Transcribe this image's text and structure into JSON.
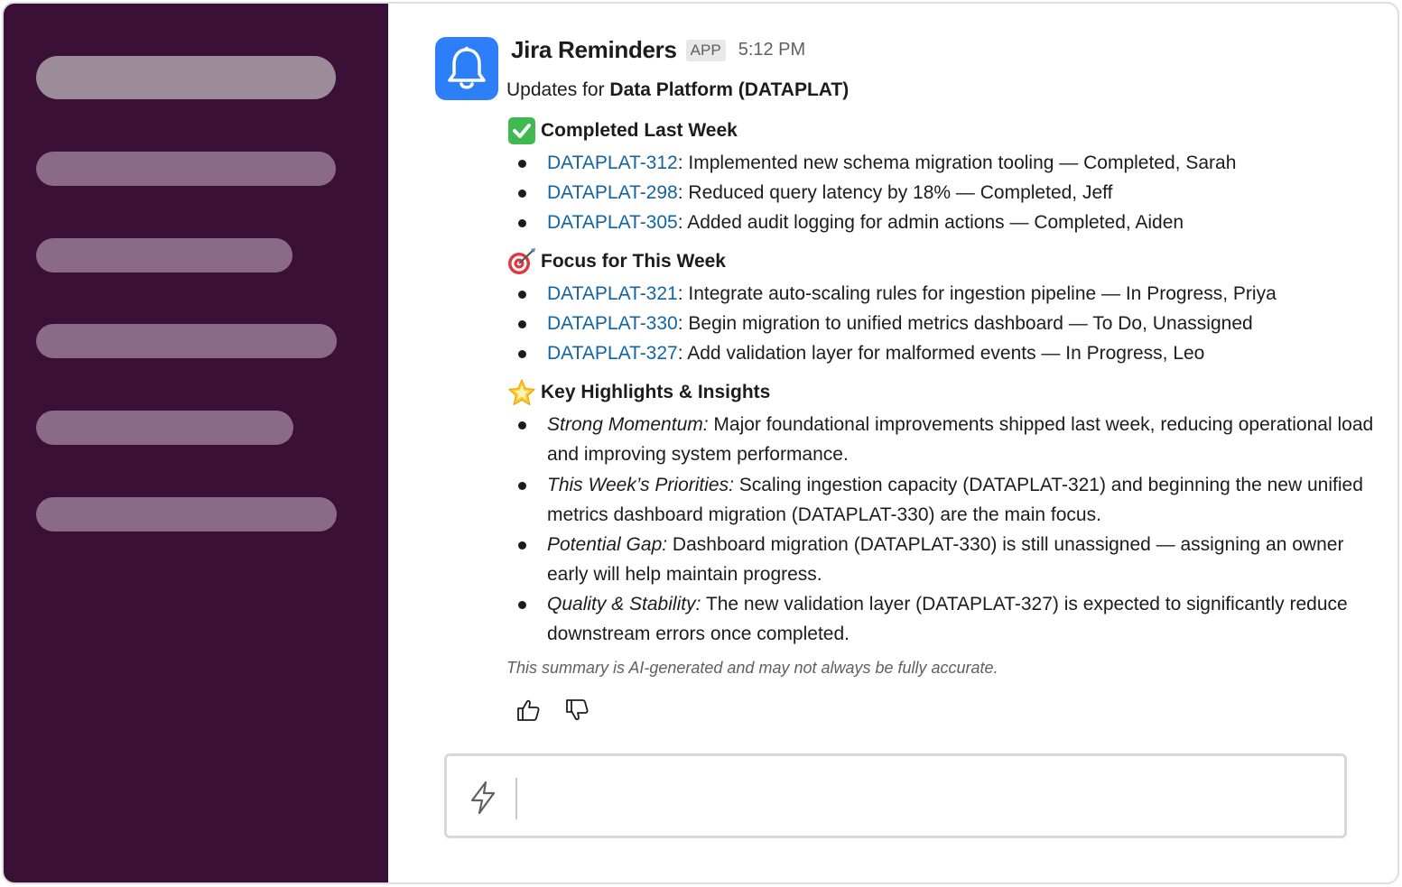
{
  "sidebar": {
    "items": [
      "",
      "",
      "",
      "",
      "",
      ""
    ]
  },
  "message": {
    "bot_name": "Jira Reminders",
    "app_badge": "APP",
    "timestamp": "5:12 PM",
    "avatar_icon": "bell-icon",
    "intro_prefix": "Updates for ",
    "intro_project": "Data Platform (DATAPLAT)"
  },
  "sections": {
    "completed": {
      "emoji": "check-mark-icon",
      "title": "Completed Last Week",
      "items": [
        {
          "key": "DATAPLAT-312",
          "text": ": Implemented new schema migration tooling — Completed, Sarah"
        },
        {
          "key": "DATAPLAT-298",
          "text": ": Reduced query latency by 18% — Completed, Jeff"
        },
        {
          "key": "DATAPLAT-305",
          "text": ": Added audit logging for admin actions — Completed, Aiden"
        }
      ]
    },
    "focus": {
      "emoji": "target-icon",
      "title": "Focus for This Week",
      "items": [
        {
          "key": "DATAPLAT-321",
          "text": ": Integrate auto-scaling rules for ingestion pipeline — In Progress, Priya"
        },
        {
          "key": "DATAPLAT-330",
          "text": ": Begin migration to unified metrics dashboard — To Do, Unassigned"
        },
        {
          "key": "DATAPLAT-327",
          "text": ": Add validation layer for malformed events — In Progress, Leo"
        }
      ]
    },
    "highlights": {
      "emoji": "star-icon",
      "title": "Key Highlights & Insights",
      "items": [
        {
          "label": "Strong Momentum:",
          "text": " Major foundational improvements shipped last week, reducing operational load and improving system performance."
        },
        {
          "label": "This Week’s Priorities:",
          "text": " Scaling ingestion capacity (DATAPLAT-321) and beginning the new unified metrics dashboard migration (DATAPLAT-330) are the main focus."
        },
        {
          "label": "Potential Gap:",
          "text": " Dashboard migration (DATAPLAT-330) is still unassigned — assigning an owner early will help maintain progress."
        },
        {
          "label": "Quality & Stability:",
          "text": " The new validation layer (DATAPLAT-327) is expected to significantly reduce downstream errors once completed."
        }
      ]
    }
  },
  "disclaimer": "This summary is AI-generated and may not always be fully accurate.",
  "reactions": {
    "up_icon": "thumbs-up-icon",
    "down_icon": "thumbs-down-icon"
  },
  "composer": {
    "icon": "lightning-icon",
    "placeholder": ""
  },
  "colors": {
    "sidebar_bg": "#3b1036",
    "link": "#1264a3",
    "avatar_bg": "#2d7ff9"
  }
}
